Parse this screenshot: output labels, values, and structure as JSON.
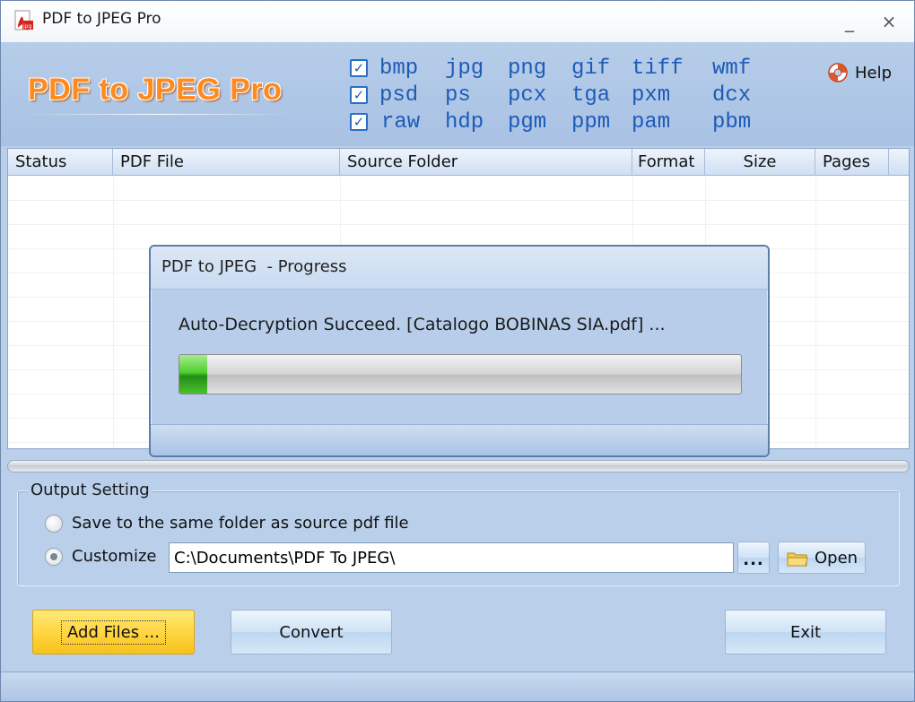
{
  "window": {
    "title": "PDF to JPEG Pro",
    "min_glyph": "_",
    "close_glyph": "×"
  },
  "header": {
    "logo_text": "PDF to JPEG Pro",
    "help_label": "Help",
    "formats": [
      [
        "bmp",
        "jpg",
        "png",
        "gif",
        "tiff",
        "wmf"
      ],
      [
        "psd",
        "ps",
        "pcx",
        "tga",
        "pxm",
        "dcx"
      ],
      [
        "raw",
        "hdp",
        "pgm",
        "ppm",
        "pam",
        "pbm"
      ]
    ],
    "check_glyph": "✓"
  },
  "list": {
    "columns": [
      "Status",
      "PDF File",
      "Source Folder",
      "Format",
      "Size",
      "Pages"
    ]
  },
  "output": {
    "group_title": "Output Setting",
    "option_same_folder": "Save to the same folder as source pdf file",
    "option_same_folder_selected": false,
    "option_customize": "Customize",
    "option_customize_selected": true,
    "path_value": "C:\\Documents\\PDF To JPEG\\",
    "browse_label": "...",
    "open_label": "Open"
  },
  "buttons": {
    "add_files": "Add Files ...",
    "convert": "Convert",
    "exit": "Exit"
  },
  "progress_dialog": {
    "title": "PDF to JPEG  - Progress",
    "message": "Auto-Decryption Succeed. [Catalogo BOBINAS SIA.pdf] ...",
    "progress": 0.05
  },
  "colors": {
    "accent_orange": "#ff8a1e",
    "format_blue": "#1e5bb8",
    "window_bg": "#b9cfea",
    "progress_green": "#3fbf24"
  }
}
